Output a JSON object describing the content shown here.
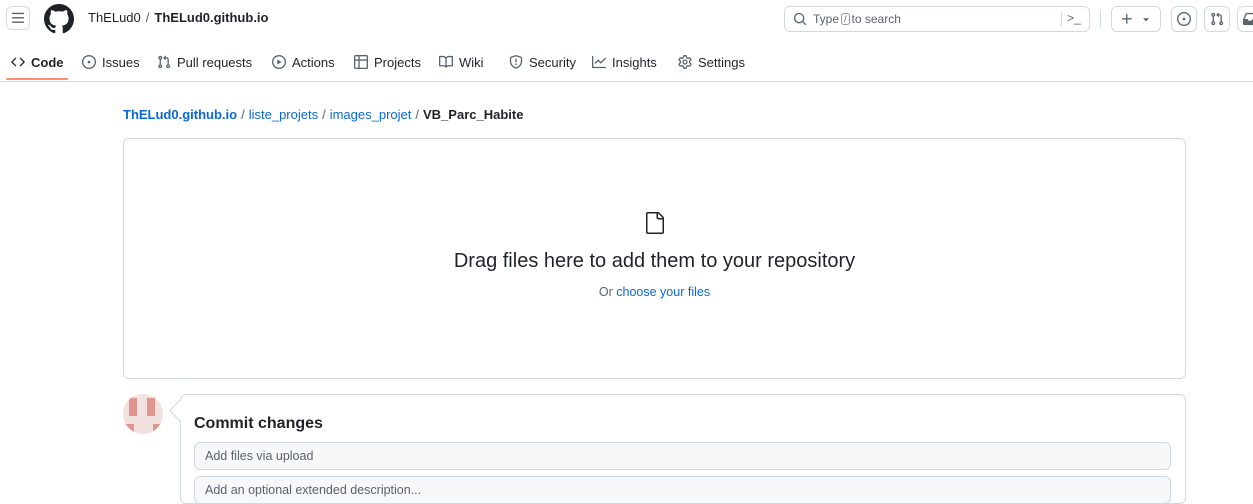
{
  "header": {
    "owner": "ThELud0",
    "separator": "/",
    "repo": "ThELud0.github.io",
    "search_prefix": "Type",
    "search_key": "/",
    "search_suffix": "to search",
    "command_glyph": ">_",
    "icons": [
      "menu-icon",
      "github-logo-icon",
      "search-icon",
      "command-palette-icon",
      "plus-icon",
      "triangle-down-icon",
      "issue-opened-icon",
      "git-pull-request-icon",
      "inbox-icon"
    ]
  },
  "nav": {
    "tabs": [
      {
        "label": "Code",
        "icon": "code-icon",
        "selected": true
      },
      {
        "label": "Issues",
        "icon": "issue-opened-icon"
      },
      {
        "label": "Pull requests",
        "icon": "git-pull-request-icon"
      },
      {
        "label": "Actions",
        "icon": "play-icon"
      },
      {
        "label": "Projects",
        "icon": "table-icon"
      },
      {
        "label": "Wiki",
        "icon": "book-icon"
      },
      {
        "label": "Security",
        "icon": "shield-icon"
      },
      {
        "label": "Insights",
        "icon": "graph-icon"
      },
      {
        "label": "Settings",
        "icon": "gear-icon"
      }
    ],
    "selected_underline_color": "#fd8c73"
  },
  "breadcrumb": {
    "items": [
      "ThELud0.github.io",
      "liste_projets",
      "images_projet"
    ],
    "separator": "/",
    "current": "VB_Parc_Habite"
  },
  "dropzone": {
    "title": "Drag files here to add them to your repository",
    "prefix": "Or",
    "link": "choose your files"
  },
  "commit": {
    "title": "Commit changes",
    "summary_placeholder": "Add files via upload",
    "description_placeholder": "Add an optional extended description..."
  },
  "colors": {
    "link": "#0969da",
    "text": "#1f2328",
    "muted": "#59636e",
    "border": "#d1d9e0"
  }
}
